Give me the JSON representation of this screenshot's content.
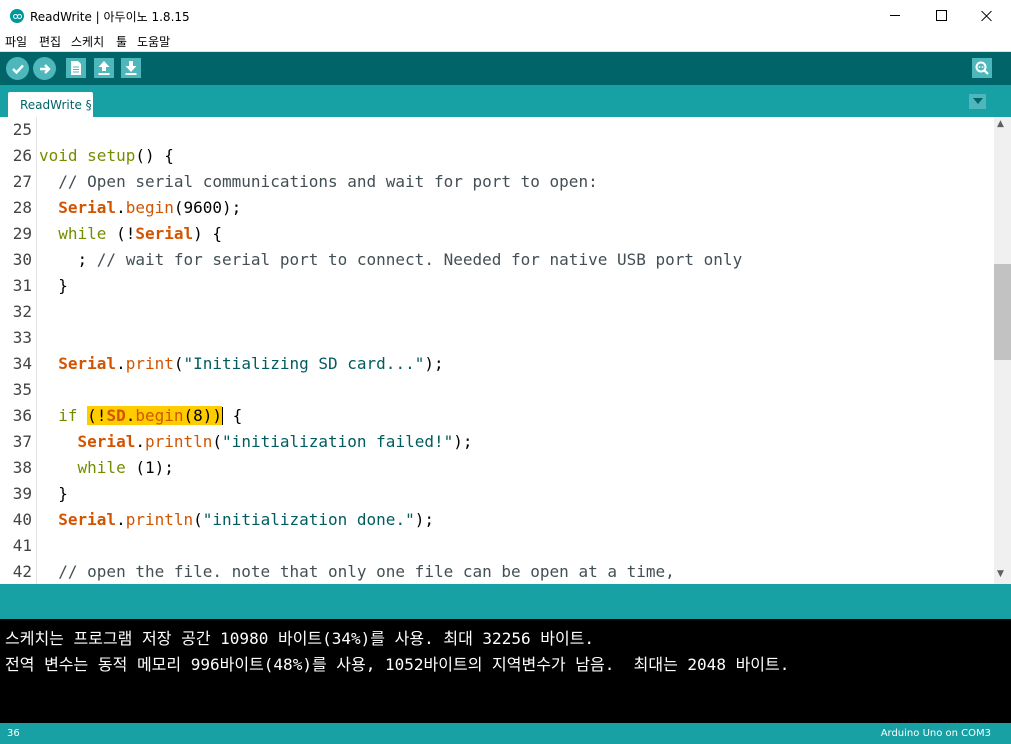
{
  "window": {
    "title": "ReadWrite | 아두이노 1.8.15"
  },
  "menu": [
    "파일",
    "편집",
    "스케치",
    "툴",
    "도움말"
  ],
  "toolbar": {
    "buttons": [
      "verify-icon",
      "upload-icon",
      "new-icon",
      "open-icon",
      "save-icon"
    ],
    "right_button": "serial-monitor-icon"
  },
  "tabs": [
    {
      "label": "ReadWrite §"
    }
  ],
  "editor": {
    "lines": [
      {
        "n": "25",
        "tokens": []
      },
      {
        "n": "26",
        "tokens": [
          {
            "t": "void",
            "c": "kw"
          },
          {
            "t": " "
          },
          {
            "t": "setup",
            "c": "kw"
          },
          {
            "t": "() {"
          }
        ]
      },
      {
        "n": "27",
        "tokens": [
          {
            "t": "  // Open serial communications and wait for port to open:",
            "c": "comment"
          }
        ]
      },
      {
        "n": "28",
        "tokens": [
          {
            "t": "  "
          },
          {
            "t": "Serial",
            "c": "class"
          },
          {
            "t": "."
          },
          {
            "t": "begin",
            "c": "func"
          },
          {
            "t": "(9600);"
          }
        ]
      },
      {
        "n": "29",
        "tokens": [
          {
            "t": "  "
          },
          {
            "t": "while",
            "c": "kw"
          },
          {
            "t": " (!"
          },
          {
            "t": "Serial",
            "c": "class"
          },
          {
            "t": ") {"
          }
        ]
      },
      {
        "n": "30",
        "tokens": [
          {
            "t": "    ; "
          },
          {
            "t": "// wait for serial port to connect. Needed for native USB port only",
            "c": "comment"
          }
        ]
      },
      {
        "n": "31",
        "tokens": [
          {
            "t": "  }"
          }
        ]
      },
      {
        "n": "32",
        "tokens": []
      },
      {
        "n": "33",
        "tokens": []
      },
      {
        "n": "34",
        "tokens": [
          {
            "t": "  "
          },
          {
            "t": "Serial",
            "c": "class"
          },
          {
            "t": "."
          },
          {
            "t": "print",
            "c": "func"
          },
          {
            "t": "("
          },
          {
            "t": "\"Initializing SD card...\"",
            "c": "string"
          },
          {
            "t": ");"
          }
        ]
      },
      {
        "n": "35",
        "tokens": []
      },
      {
        "n": "36",
        "tokens": [
          {
            "t": "  "
          },
          {
            "t": "if",
            "c": "kw"
          },
          {
            "t": " "
          },
          {
            "t": "(!",
            "hl": true
          },
          {
            "t": "SD",
            "c": "class",
            "hl": true
          },
          {
            "t": ".",
            "hl": true
          },
          {
            "t": "begin",
            "c": "func",
            "hl": true
          },
          {
            "t": "(8))",
            "hl": true
          },
          {
            "caret": true
          },
          {
            "t": " {"
          }
        ]
      },
      {
        "n": "37",
        "tokens": [
          {
            "t": "    "
          },
          {
            "t": "Serial",
            "c": "class"
          },
          {
            "t": "."
          },
          {
            "t": "println",
            "c": "func"
          },
          {
            "t": "("
          },
          {
            "t": "\"initialization failed!\"",
            "c": "string"
          },
          {
            "t": ");"
          }
        ]
      },
      {
        "n": "38",
        "tokens": [
          {
            "t": "    "
          },
          {
            "t": "while",
            "c": "kw"
          },
          {
            "t": " (1);"
          }
        ]
      },
      {
        "n": "39",
        "tokens": [
          {
            "t": "  }"
          }
        ]
      },
      {
        "n": "40",
        "tokens": [
          {
            "t": "  "
          },
          {
            "t": "Serial",
            "c": "class"
          },
          {
            "t": "."
          },
          {
            "t": "println",
            "c": "func"
          },
          {
            "t": "("
          },
          {
            "t": "\"initialization done.\"",
            "c": "string"
          },
          {
            "t": ");"
          }
        ]
      },
      {
        "n": "41",
        "tokens": []
      },
      {
        "n": "42",
        "tokens": [
          {
            "t": "  // open the file. note that only one file can be open at a time,",
            "c": "comment"
          }
        ]
      }
    ]
  },
  "console": {
    "lines": [
      "스케치는 프로그램 저장 공간 10980 바이트(34%)를 사용. 최대 32256 바이트.",
      "전역 변수는 동적 메모리 996바이트(48%)를 사용, 1052바이트의 지역변수가 남음.  최대는 2048 바이트."
    ]
  },
  "status": {
    "line": "36",
    "board": "Arduino Uno on COM3"
  },
  "colors": {
    "toolbar": "#006468",
    "tabbar": "#17a1a5",
    "button": "#4db7bb",
    "keyword": "#728e00",
    "function": "#d35400",
    "string": "#005c5f",
    "comment": "#434f54",
    "highlight": "#ffcc00",
    "console_bg": "#000000"
  }
}
